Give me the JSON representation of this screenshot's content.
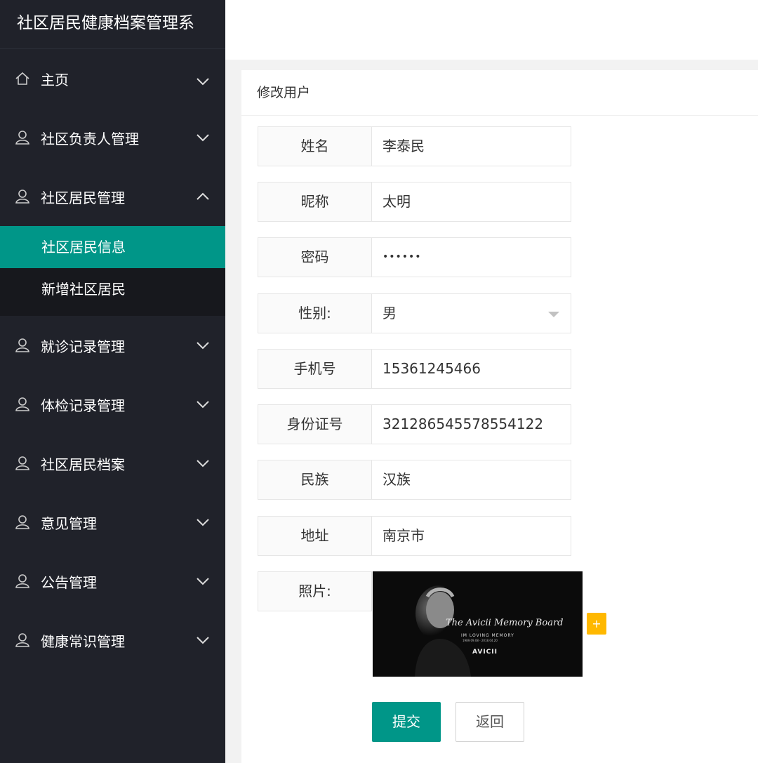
{
  "app": {
    "title": "社区居民健康档案管理系"
  },
  "sidebar": {
    "items": [
      {
        "label": "主页",
        "icon": "home-icon"
      },
      {
        "label": "社区负责人管理",
        "icon": "user-icon"
      },
      {
        "label": "社区居民管理",
        "icon": "user-icon",
        "expanded": true,
        "children": [
          {
            "label": "社区居民信息",
            "active": true
          },
          {
            "label": "新增社区居民"
          }
        ]
      },
      {
        "label": "就诊记录管理",
        "icon": "user-icon"
      },
      {
        "label": "体检记录管理",
        "icon": "user-icon"
      },
      {
        "label": "社区居民档案",
        "icon": "user-icon"
      },
      {
        "label": "意见管理",
        "icon": "user-icon"
      },
      {
        "label": "公告管理",
        "icon": "user-icon"
      },
      {
        "label": "健康常识管理",
        "icon": "user-icon"
      }
    ]
  },
  "form": {
    "title": "修改用户",
    "fields": [
      {
        "label": "姓名",
        "value": "李泰民"
      },
      {
        "label": "昵称",
        "value": "太明"
      },
      {
        "label": "密码",
        "value": "••••••"
      },
      {
        "label": "性别:",
        "value": "男"
      },
      {
        "label": "手机号",
        "value": "15361245466"
      },
      {
        "label": "身份证号",
        "value": "321286545578554122"
      },
      {
        "label": "民族",
        "value": "汉族"
      },
      {
        "label": "地址",
        "value": "南京市"
      }
    ],
    "photo_label": "照片:",
    "photo": {
      "text1": "The Avicii Memory Board",
      "text2": "IM LOVING MEMORY",
      "text3": "1989.09.08 - 2018.04.20",
      "text4": "AVICII"
    },
    "add_label": "+",
    "submit_label": "提交",
    "back_label": "返回"
  },
  "colors": {
    "sidebar_bg": "#20222a",
    "accent": "#009688",
    "warn": "#ffb800"
  }
}
